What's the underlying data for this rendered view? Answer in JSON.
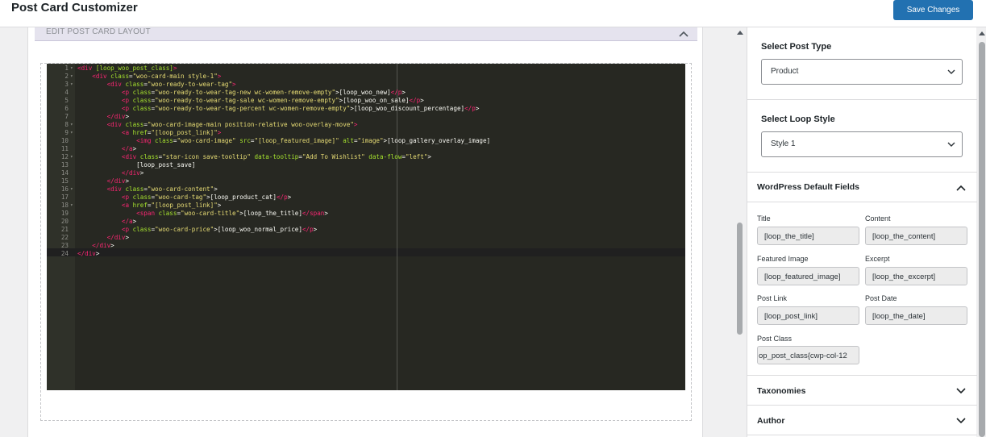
{
  "header": {
    "title": "Post Card Customizer",
    "save_label": "Save Changes"
  },
  "editor_section": {
    "title": "EDIT POST CARD LAYOUT"
  },
  "code_lines": [
    [
      [
        "t",
        "<div"
      ],
      [
        "a",
        " [loop_woo_post_class]"
      ],
      [
        "t",
        ">"
      ]
    ],
    [
      [
        "p",
        "    "
      ],
      [
        "t",
        "<div"
      ],
      [
        "a",
        " class"
      ],
      [
        "p",
        "="
      ],
      [
        "s",
        "\"woo-card-main style-1\""
      ],
      [
        "t",
        ">"
      ]
    ],
    [
      [
        "p",
        "        "
      ],
      [
        "t",
        "<div"
      ],
      [
        "a",
        " class"
      ],
      [
        "p",
        "="
      ],
      [
        "s",
        "\"woo-ready-to-wear-tag\""
      ],
      [
        "t",
        ">"
      ]
    ],
    [
      [
        "p",
        "            "
      ],
      [
        "t",
        "<p"
      ],
      [
        "a",
        " class"
      ],
      [
        "p",
        "="
      ],
      [
        "s",
        "\"woo-ready-to-wear-tag-new wc-women-remove-empty\""
      ],
      [
        "p",
        ">[loop_woo_new]"
      ],
      [
        "t",
        "</p"
      ],
      [
        "p",
        ">"
      ]
    ],
    [
      [
        "p",
        "            "
      ],
      [
        "t",
        "<p"
      ],
      [
        "a",
        " class"
      ],
      [
        "p",
        "="
      ],
      [
        "s",
        "\"woo-ready-to-wear-tag-sale wc-women-remove-empty\""
      ],
      [
        "p",
        ">[loop_woo_on_sale]"
      ],
      [
        "t",
        "</p"
      ],
      [
        "p",
        ">"
      ]
    ],
    [
      [
        "p",
        "            "
      ],
      [
        "t",
        "<p"
      ],
      [
        "a",
        " class"
      ],
      [
        "p",
        "="
      ],
      [
        "s",
        "\"woo-ready-to-wear-tag-percent wc-women-remove-empty\""
      ],
      [
        "p",
        ">[loop_woo_discount_percentage]"
      ],
      [
        "t",
        "</p"
      ],
      [
        "p",
        ">"
      ]
    ],
    [
      [
        "p",
        "        "
      ],
      [
        "t",
        "</div"
      ],
      [
        "p",
        ">"
      ]
    ],
    [
      [
        "p",
        "        "
      ],
      [
        "t",
        "<div"
      ],
      [
        "a",
        " class"
      ],
      [
        "p",
        "="
      ],
      [
        "s",
        "\"woo-card-image-main position-relative woo-overlay-move\""
      ],
      [
        "t",
        ">"
      ]
    ],
    [
      [
        "p",
        "            "
      ],
      [
        "t",
        "<a"
      ],
      [
        "a",
        " href"
      ],
      [
        "p",
        "="
      ],
      [
        "s",
        "\"[loop_post_link]\""
      ],
      [
        "t",
        ">"
      ]
    ],
    [
      [
        "p",
        "                "
      ],
      [
        "t",
        "<img"
      ],
      [
        "a",
        " class"
      ],
      [
        "p",
        "="
      ],
      [
        "s",
        "\"woo-card-image\""
      ],
      [
        "a",
        " src"
      ],
      [
        "p",
        "="
      ],
      [
        "s",
        "\"[loop_featured_image]\""
      ],
      [
        "a",
        " alt"
      ],
      [
        "p",
        "="
      ],
      [
        "s",
        "\"image\""
      ],
      [
        "p",
        ">[loop_gallery_overlay_image]"
      ]
    ],
    [
      [
        "p",
        "            "
      ],
      [
        "t",
        "</a"
      ],
      [
        "p",
        ">"
      ]
    ],
    [
      [
        "p",
        "            "
      ],
      [
        "t",
        "<div"
      ],
      [
        "a",
        " class"
      ],
      [
        "p",
        "="
      ],
      [
        "s",
        "\"star-icon save-tooltip\""
      ],
      [
        "a",
        " data-tooltip"
      ],
      [
        "p",
        "="
      ],
      [
        "s",
        "\"Add To Wishlist\""
      ],
      [
        "a",
        " data-flow"
      ],
      [
        "p",
        "="
      ],
      [
        "s",
        "\"left\""
      ],
      [
        "p",
        ">"
      ]
    ],
    [
      [
        "p",
        "                [loop_post_save]"
      ]
    ],
    [
      [
        "p",
        "            "
      ],
      [
        "t",
        "</div"
      ],
      [
        "p",
        ">"
      ]
    ],
    [
      [
        "p",
        "        "
      ],
      [
        "t",
        "</div"
      ],
      [
        "p",
        ">"
      ]
    ],
    [
      [
        "p",
        "        "
      ],
      [
        "t",
        "<div"
      ],
      [
        "a",
        " class"
      ],
      [
        "p",
        "="
      ],
      [
        "s",
        "\"woo-card-content\""
      ],
      [
        "p",
        ">"
      ]
    ],
    [
      [
        "p",
        "            "
      ],
      [
        "t",
        "<p"
      ],
      [
        "a",
        " class"
      ],
      [
        "p",
        "="
      ],
      [
        "s",
        "\"woo-card-tag\""
      ],
      [
        "p",
        ">[loop_product_cat]"
      ],
      [
        "t",
        "</p"
      ],
      [
        "p",
        ">"
      ]
    ],
    [
      [
        "p",
        "            "
      ],
      [
        "t",
        "<a"
      ],
      [
        "a",
        " href"
      ],
      [
        "p",
        "="
      ],
      [
        "s",
        "\"[loop_post_link]\""
      ],
      [
        "p",
        ">"
      ]
    ],
    [
      [
        "p",
        "                "
      ],
      [
        "t",
        "<span"
      ],
      [
        "a",
        " class"
      ],
      [
        "p",
        "="
      ],
      [
        "s",
        "\"woo-card-title\""
      ],
      [
        "p",
        ">[loop_the_title]"
      ],
      [
        "t",
        "</span"
      ],
      [
        "p",
        ">"
      ]
    ],
    [
      [
        "p",
        "            "
      ],
      [
        "t",
        "</a"
      ],
      [
        "p",
        ">"
      ]
    ],
    [
      [
        "p",
        "            "
      ],
      [
        "t",
        "<p"
      ],
      [
        "a",
        " class"
      ],
      [
        "p",
        "="
      ],
      [
        "s",
        "\"woo-card-price\""
      ],
      [
        "p",
        ">[loop_woo_normal_price]"
      ],
      [
        "t",
        "</p"
      ],
      [
        "p",
        ">"
      ]
    ],
    [
      [
        "p",
        "        "
      ],
      [
        "t",
        "</div"
      ],
      [
        "p",
        ">"
      ]
    ],
    [
      [
        "p",
        "    "
      ],
      [
        "t",
        "</div"
      ],
      [
        "p",
        ">"
      ]
    ],
    [
      [
        "t",
        "</div"
      ],
      [
        "p",
        ">"
      ]
    ]
  ],
  "fold_lines": [
    1,
    2,
    3,
    8,
    9,
    12,
    16,
    18
  ],
  "sidebar": {
    "post_type": {
      "label": "Select Post Type",
      "value": "Product"
    },
    "loop_style": {
      "label": "Select Loop Style",
      "value": "Style 1"
    },
    "default_fields": {
      "title": "WordPress Default Fields",
      "fields": [
        {
          "label": "Title",
          "value": "[loop_the_title]"
        },
        {
          "label": "Content",
          "value": "[loop_the_content]"
        },
        {
          "label": "Featured Image",
          "value": "[loop_featured_image]"
        },
        {
          "label": "Excerpt",
          "value": "[loop_the_excerpt]"
        },
        {
          "label": "Post Link",
          "value": "[loop_post_link]"
        },
        {
          "label": "Post Date",
          "value": "[loop_the_date]"
        },
        {
          "label": "Post Class",
          "value": "op_post_class{cwp-col-12"
        }
      ]
    },
    "taxonomies": {
      "title": "Taxonomies"
    },
    "author": {
      "title": "Author"
    }
  }
}
